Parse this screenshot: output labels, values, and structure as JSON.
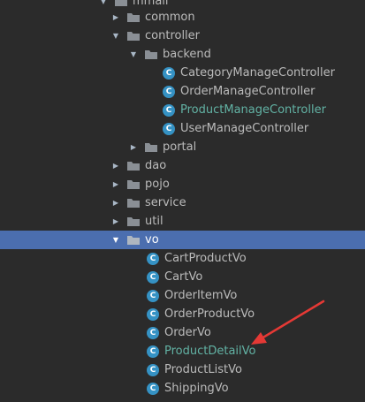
{
  "tree": {
    "top_partial": {
      "label": "mmall"
    },
    "items": [
      {
        "label": "common"
      },
      {
        "label": "controller"
      },
      {
        "label": "backend"
      },
      {
        "label": "CategoryManageController",
        "icon": "C"
      },
      {
        "label": "OrderManageController",
        "icon": "C"
      },
      {
        "label": "ProductManageController",
        "icon": "C"
      },
      {
        "label": "UserManageController",
        "icon": "C"
      },
      {
        "label": "portal"
      },
      {
        "label": "dao"
      },
      {
        "label": "pojo"
      },
      {
        "label": "service"
      },
      {
        "label": "util"
      },
      {
        "label": "vo"
      },
      {
        "label": "CartProductVo",
        "icon": "C"
      },
      {
        "label": "CartVo",
        "icon": "C"
      },
      {
        "label": "OrderItemVo",
        "icon": "C"
      },
      {
        "label": "OrderProductVo",
        "icon": "C"
      },
      {
        "label": "OrderVo",
        "icon": "C"
      },
      {
        "label": "ProductDetailVo",
        "icon": "C"
      },
      {
        "label": "ProductListVo",
        "icon": "C"
      },
      {
        "label": "ShippingVo",
        "icon": "C"
      }
    ]
  },
  "colors": {
    "background": "#2b2b2b",
    "selection": "#4b6eaf",
    "modified_text": "#62b2a4",
    "class_icon": "#3592c4",
    "annotation_arrow": "#e53935"
  }
}
